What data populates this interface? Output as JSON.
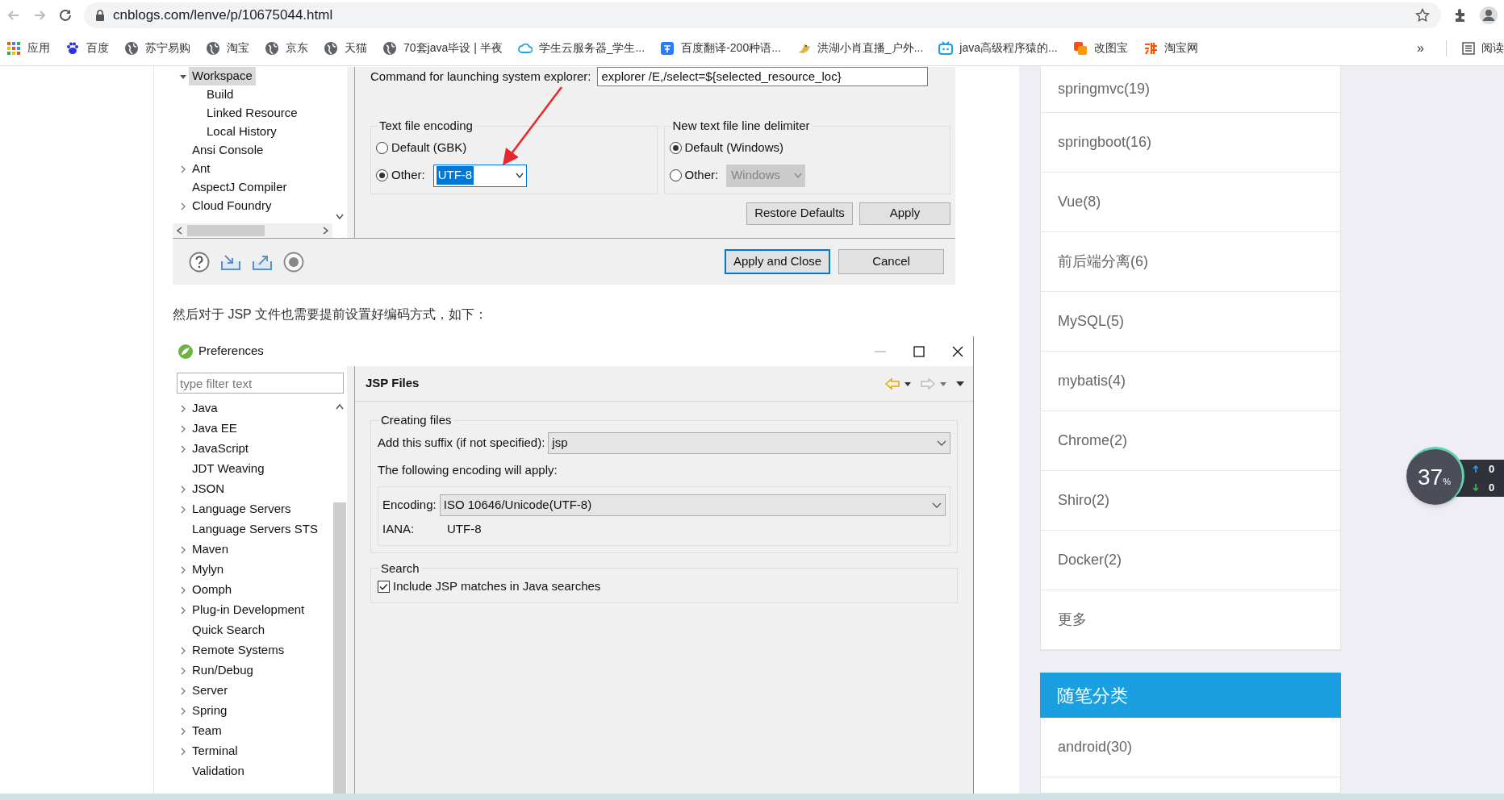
{
  "browser": {
    "url": "cnblogs.com/lenve/p/10675044.html",
    "bookmarks": [
      {
        "label": "应用",
        "kind": "apps"
      },
      {
        "label": "百度",
        "kind": "paw"
      },
      {
        "label": "苏宁易购",
        "kind": "globe"
      },
      {
        "label": "淘宝",
        "kind": "globe"
      },
      {
        "label": "京东",
        "kind": "globe"
      },
      {
        "label": "天猫",
        "kind": "globe"
      },
      {
        "label": "70套java毕设 | 半夜",
        "kind": "globe"
      },
      {
        "label": "学生云服务器_学生...",
        "kind": "cloud"
      },
      {
        "label": "百度翻译-200种语...",
        "kind": "translate"
      },
      {
        "label": "洪湖小肖直播_户外...",
        "kind": "bird"
      },
      {
        "label": "java高级程序猿的...",
        "kind": "tv"
      },
      {
        "label": "改图宝",
        "kind": "tile"
      },
      {
        "label": "淘宝网",
        "kind": "tao"
      }
    ],
    "overflow": "»",
    "reading_list": "阅读"
  },
  "article": {
    "screenshot_1": {
      "tree": [
        {
          "label": "Workspace",
          "expandable": true,
          "expanded": true,
          "selected": true,
          "children": [
            {
              "label": "Build",
              "expandable": false,
              "selected": false
            },
            {
              "label": "Linked Resource",
              "expandable": false,
              "selected": false
            },
            {
              "label": "Local History",
              "expandable": false,
              "selected": false
            }
          ]
        },
        {
          "label": "Ansi Console",
          "expandable": false,
          "selected": false
        },
        {
          "label": "Ant",
          "expandable": true,
          "expanded": false,
          "selected": false
        },
        {
          "label": "AspectJ Compiler",
          "expandable": false,
          "selected": false
        },
        {
          "label": "Cloud Foundry",
          "expandable": true,
          "expanded": false,
          "selected": false
        }
      ],
      "command_label": "Command for launching system explorer:",
      "command_value": "explorer /E,/select=${selected_resource_loc}",
      "groups": [
        {
          "title": "Text file encoding",
          "options": [
            {
              "label": "Default (GBK)",
              "selected": false
            },
            {
              "label": "Other:",
              "selected": true
            }
          ],
          "combo_value": "UTF-8",
          "combo_disabled": false,
          "combo_text_selected": true
        },
        {
          "title": "New text file line delimiter",
          "options": [
            {
              "label": "Default (Windows)",
              "selected": true
            },
            {
              "label": "Other:",
              "selected": false
            }
          ],
          "combo_value": "Windows",
          "combo_disabled": true,
          "combo_text_selected": false
        }
      ],
      "buttons": [
        "Restore Defaults",
        "Apply"
      ],
      "footer_buttons": [
        {
          "label": "Apply and Close",
          "default": true
        },
        {
          "label": "Cancel",
          "default": false
        }
      ]
    },
    "paragraph": "然后对于 JSP 文件也需要提前设置好编码方式，如下：",
    "screenshot_2": {
      "title": "Preferences",
      "filter_placeholder": "type filter text",
      "tree": [
        {
          "label": "Java",
          "expandable": true,
          "expanded": false
        },
        {
          "label": "Java EE",
          "expandable": true,
          "expanded": false
        },
        {
          "label": "JavaScript",
          "expandable": true,
          "expanded": false
        },
        {
          "label": "JDT Weaving",
          "expandable": false
        },
        {
          "label": "JSON",
          "expandable": true,
          "expanded": false
        },
        {
          "label": "Language Servers",
          "expandable": true,
          "expanded": false
        },
        {
          "label": "Language Servers STS",
          "expandable": false
        },
        {
          "label": "Maven",
          "expandable": true,
          "expanded": false
        },
        {
          "label": "Mylyn",
          "expandable": true,
          "expanded": false
        },
        {
          "label": "Oomph",
          "expandable": true,
          "expanded": false
        },
        {
          "label": "Plug-in Development",
          "expandable": true,
          "expanded": false
        },
        {
          "label": "Quick Search",
          "expandable": false
        },
        {
          "label": "Remote Systems",
          "expandable": true,
          "expanded": false
        },
        {
          "label": "Run/Debug",
          "expandable": true,
          "expanded": false
        },
        {
          "label": "Server",
          "expandable": true,
          "expanded": false
        },
        {
          "label": "Spring",
          "expandable": true,
          "expanded": false
        },
        {
          "label": "Team",
          "expandable": true,
          "expanded": false
        },
        {
          "label": "Terminal",
          "expandable": true,
          "expanded": false
        },
        {
          "label": "Validation",
          "expandable": false
        }
      ],
      "page_title": "JSP Files",
      "creating_group": {
        "title": "Creating files",
        "suffix_label": "Add this suffix (if not specified):",
        "suffix_value": "jsp",
        "encoding_note": "The following encoding will apply:",
        "encoding_label": "Encoding:",
        "encoding_value": "ISO 10646/Unicode(UTF-8)",
        "iana_label": "IANA:",
        "iana_value": "UTF-8"
      },
      "search_group": {
        "title": "Search",
        "checkbox_label": "Include JSP matches in Java searches",
        "checked": true
      }
    }
  },
  "sidebar": {
    "items": [
      "springmvc(19)",
      "springboot(16)",
      "Vue(8)",
      "前后端分离(6)",
      "MySQL(5)",
      "mybatis(4)",
      "Chrome(2)",
      "Shiro(2)",
      "Docker(2)",
      "更多"
    ],
    "section_title": "随笔分类",
    "section_items": [
      "android(30)"
    ]
  },
  "net_meter": {
    "percent": "37",
    "unit": "%",
    "upload": "0",
    "download": "0"
  }
}
